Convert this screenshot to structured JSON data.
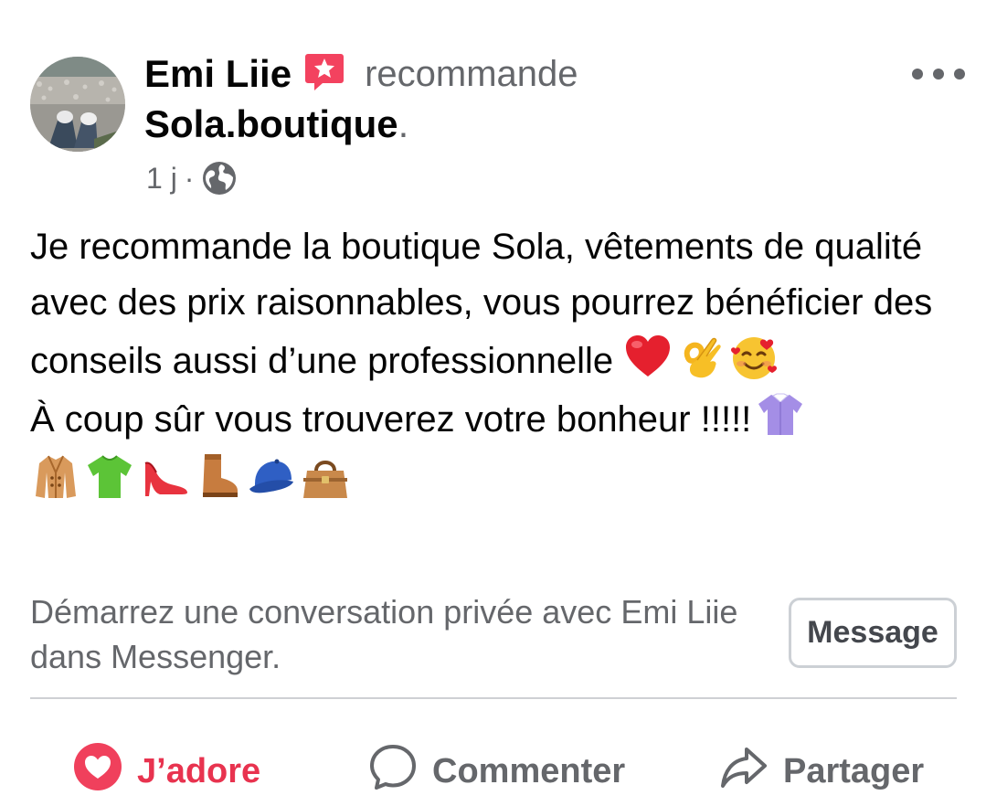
{
  "post": {
    "author": "Emi Liie",
    "action_text": "recommande",
    "page_name": "Sola.boutique",
    "page_suffix": ".",
    "time": "1 j",
    "separator": "·",
    "privacy_icon": "globe-icon",
    "body": {
      "line1": "Je recommande la boutique Sola, vêtements de qualité avec des prix raisonnables, vous pourrez bénéficier des conseils aussi d’une professionnelle",
      "line1_emojis": [
        "red-heart",
        "ok-hand",
        "smiling-face-with-hearts"
      ],
      "line2": "À coup sûr vous trouverez votre bonheur !!!!!",
      "line2_emojis": [
        "blouse",
        "coat",
        "t-shirt",
        "high-heeled-shoe",
        "boot",
        "cap",
        "handbag"
      ]
    }
  },
  "cta": {
    "text": "Démarrez une conversation privée avec Emi Liie dans Messenger.",
    "button_label": "Message"
  },
  "actions": {
    "love_label": "J’adore",
    "comment_label": "Commenter",
    "share_label": "Partager"
  },
  "colors": {
    "love": "#e8334f",
    "secondary_text": "#65676b",
    "recommend_badge": "#f3425f"
  }
}
